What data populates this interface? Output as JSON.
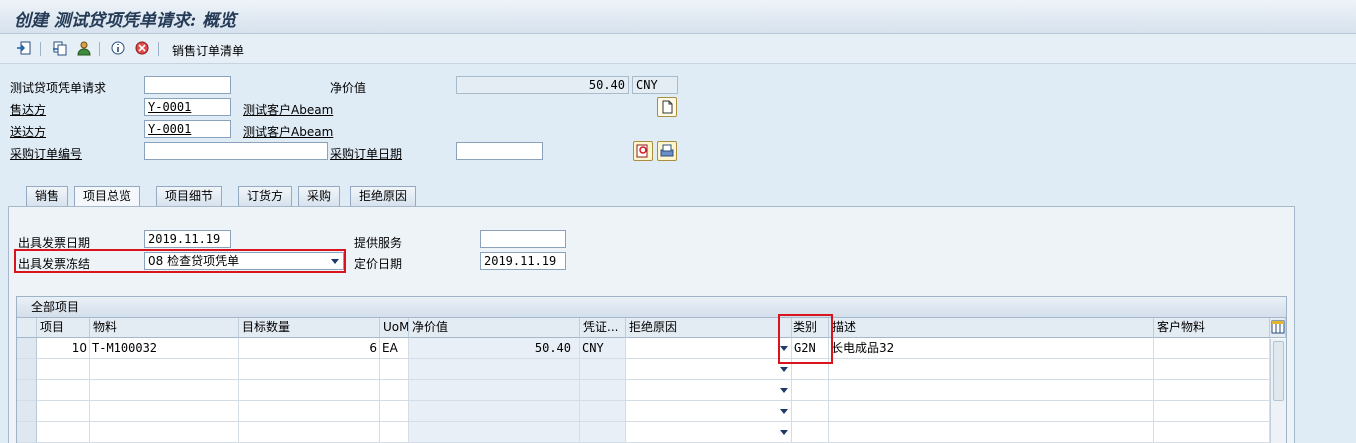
{
  "window": {
    "title": "创建 测试贷项凭单请求: 概览"
  },
  "toolbar": {
    "icons": [
      "display-object-icon",
      "copy-icon",
      "person-icon",
      "info-icon",
      "delete-icon"
    ],
    "sales_order_list": "销售订单清单"
  },
  "header": {
    "credit_memo_request_label": "测试贷项凭单请求",
    "credit_memo_request_value": "",
    "net_value_label": "净价值",
    "net_value": "50.40",
    "currency": "CNY",
    "sold_to_label": "售达方",
    "sold_to_value": "Y-0001",
    "sold_to_name": "测试客户Abeam",
    "ship_to_label": "送达方",
    "ship_to_value": "Y-0001",
    "ship_to_name": "测试客户Abeam",
    "po_number_label": "采购订单编号",
    "po_number_value": "",
    "po_date_label": "采购订单日期",
    "po_date_value": ""
  },
  "tabs": [
    "销售",
    "项目总览",
    "项目细节",
    "订货方",
    "采购",
    "拒绝原因"
  ],
  "active_tab": "项目总览",
  "overview": {
    "billing_date_label": "出具发票日期",
    "billing_date": "2019.11.19",
    "billing_block_label": "出具发票冻结",
    "billing_block_value": "08 检查贷项凭单",
    "service_label": "提供服务",
    "service_value": "",
    "pricing_date_label": "定价日期",
    "pricing_date": "2019.11.19"
  },
  "items_table": {
    "title": "全部项目",
    "columns": [
      "项目",
      "物料",
      "目标数量",
      "UoM",
      "净价值",
      "凭证...",
      "拒绝原因",
      "类别",
      "描述",
      "客户物料"
    ],
    "rows": [
      {
        "item": "10",
        "material": "T-M100032",
        "qty": "6",
        "uom": "EA",
        "net": "50.40",
        "curr": "CNY",
        "reason": "",
        "category": "G2N",
        "desc": "长电成品32",
        "cust_mat": ""
      }
    ]
  },
  "colors": {
    "highlight": "#d9141c",
    "background": "#dfebf5"
  }
}
